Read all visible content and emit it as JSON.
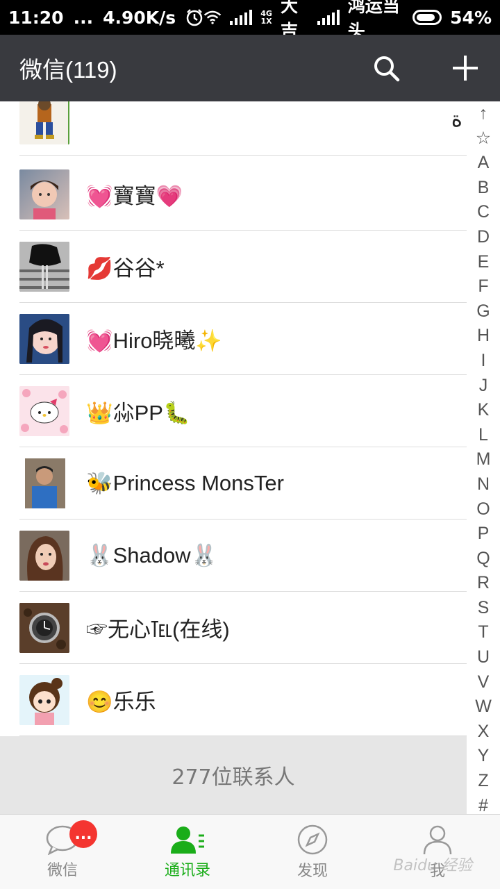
{
  "status_bar": {
    "time": "11:20",
    "dots": "...",
    "speed": "4.90K/s",
    "net1": "4G",
    "net2": "1X",
    "carrier1": "大吉",
    "carrier2": "鸿运当头",
    "battery": "54%"
  },
  "header": {
    "title": "微信(119)",
    "search_icon": "search-icon",
    "add_icon": "plus-icon"
  },
  "contacts": [
    {
      "name": "ة"
    },
    {
      "name": "💓寶寶💗"
    },
    {
      "name": "💋谷谷*"
    },
    {
      "name": "💓Hiro晓曦✨"
    },
    {
      "name": "👑尛PP🐛"
    },
    {
      "name": "🐝Princess MonsTer"
    },
    {
      "name": "🐰Shadow🐰"
    },
    {
      "name": "☞无心℡(在线)"
    },
    {
      "name": "😊乐乐"
    }
  ],
  "index_letters": [
    "↑",
    "☆",
    "A",
    "B",
    "C",
    "D",
    "E",
    "F",
    "G",
    "H",
    "I",
    "J",
    "K",
    "L",
    "M",
    "N",
    "O",
    "P",
    "Q",
    "R",
    "S",
    "T",
    "U",
    "V",
    "W",
    "X",
    "Y",
    "Z",
    "#"
  ],
  "footer": {
    "count_text": "277位联系人"
  },
  "tabs": [
    {
      "label": "微信",
      "icon": "chat-bubble-icon",
      "badge": "..."
    },
    {
      "label": "通讯录",
      "icon": "contacts-icon",
      "active": true
    },
    {
      "label": "发现",
      "icon": "compass-icon"
    },
    {
      "label": "我",
      "icon": "person-icon"
    }
  ],
  "watermark": "Baidu 经验",
  "colors": {
    "header_bg": "#393a3f",
    "active_tab": "#1aad19",
    "badge": "#f43530"
  }
}
